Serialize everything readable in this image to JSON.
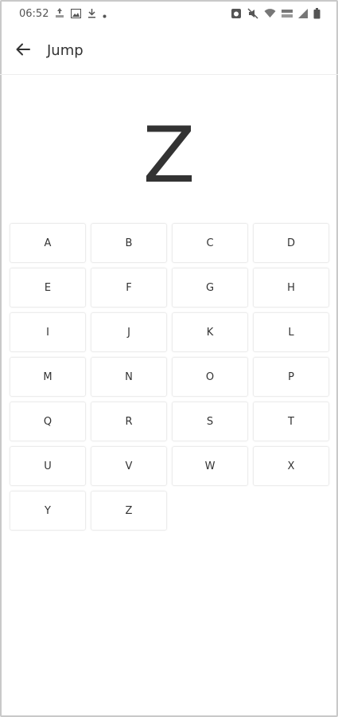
{
  "status_bar": {
    "time": "06:52",
    "icons": [
      "nfc-icon",
      "image-icon",
      "download-icon",
      "dot-icon",
      "alarm-icon",
      "mute-icon",
      "wifi-icon",
      "volte-icon",
      "signal-icon",
      "battery-icon"
    ]
  },
  "app_bar": {
    "title": "Jump",
    "back_icon": "arrow-left-icon"
  },
  "current_letter": "Z",
  "letters": [
    "A",
    "B",
    "C",
    "D",
    "E",
    "F",
    "G",
    "H",
    "I",
    "J",
    "K",
    "L",
    "M",
    "N",
    "O",
    "P",
    "Q",
    "R",
    "S",
    "T",
    "U",
    "V",
    "W",
    "X",
    "Y",
    "Z"
  ]
}
